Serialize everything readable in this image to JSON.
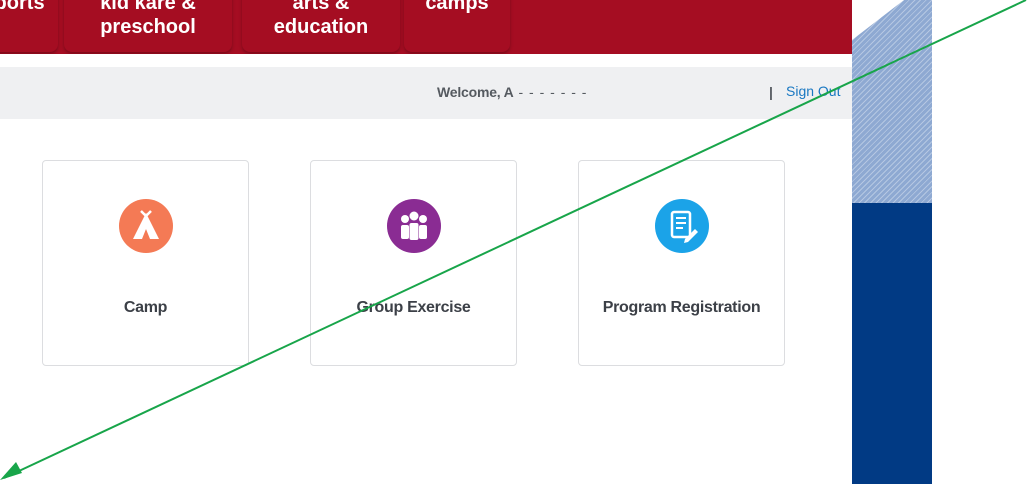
{
  "nav": {
    "tabs": [
      {
        "line1": "sports",
        "line2": ""
      },
      {
        "line1": "kid kare &",
        "line2": "preschool"
      },
      {
        "line1": "arts &",
        "line2": "education"
      },
      {
        "line1": "camps",
        "line2": ""
      }
    ]
  },
  "welcome": {
    "prefix": "Welcome, A",
    "masked": " - - - - - - -",
    "separator": "|",
    "sign_out": "Sign Out"
  },
  "cards": [
    {
      "label": "Camp",
      "icon": "tent-icon",
      "color": "#f47a55"
    },
    {
      "label": "Group Exercise",
      "icon": "group-people-icon",
      "color": "#8a2c93"
    },
    {
      "label": "Program Registration",
      "icon": "registration-form-icon",
      "color": "#1ba3e8"
    }
  ],
  "colors": {
    "nav_red": "#a50d22",
    "welcome_bg": "#eff0f2",
    "link_blue": "#1a78c2",
    "side_blue": "#013a84",
    "annotation_green": "#18a54a"
  }
}
